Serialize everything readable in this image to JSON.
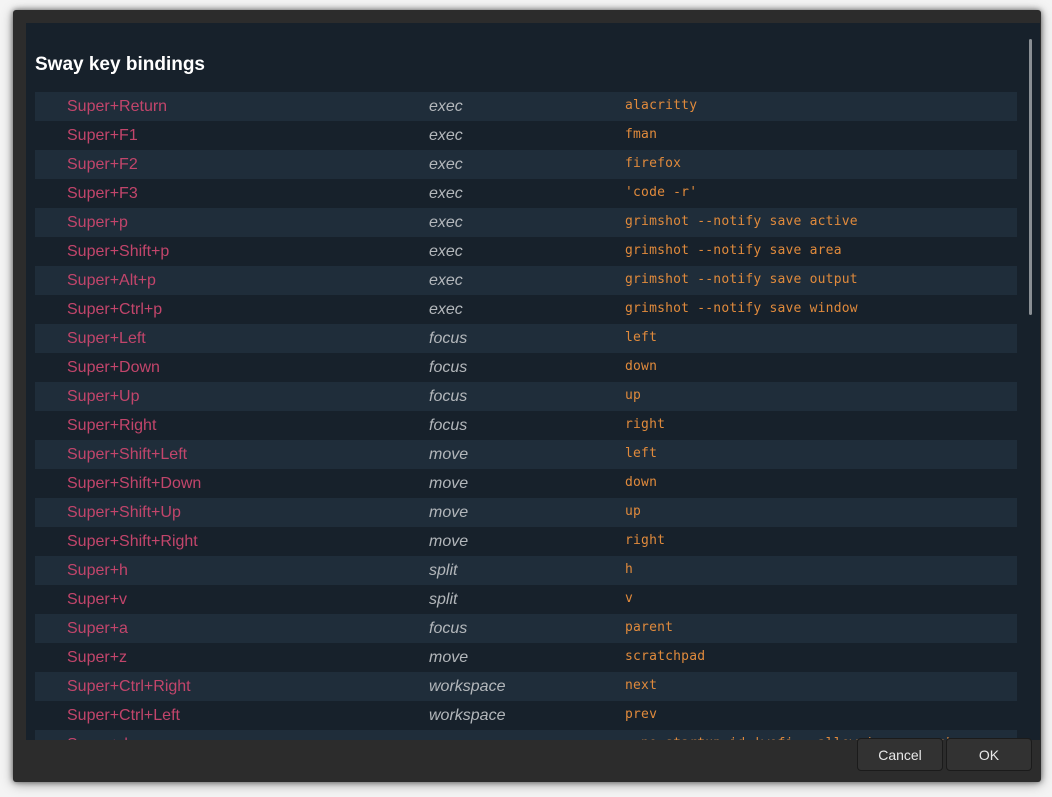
{
  "dialog": {
    "title": "Sway key bindings",
    "cancel_label": "Cancel",
    "ok_label": "OK"
  },
  "bindings": [
    {
      "key": "Super+Return",
      "action": "exec",
      "arg": "alacritty"
    },
    {
      "key": "Super+F1",
      "action": "exec",
      "arg": "fman"
    },
    {
      "key": "Super+F2",
      "action": "exec",
      "arg": "firefox"
    },
    {
      "key": "Super+F3",
      "action": "exec",
      "arg": "'code -r'"
    },
    {
      "key": "Super+p",
      "action": "exec",
      "arg": "grimshot --notify save active"
    },
    {
      "key": "Super+Shift+p",
      "action": "exec",
      "arg": "grimshot --notify save area"
    },
    {
      "key": "Super+Alt+p",
      "action": "exec",
      "arg": "grimshot --notify save output"
    },
    {
      "key": "Super+Ctrl+p",
      "action": "exec",
      "arg": "grimshot --notify save window"
    },
    {
      "key": "Super+Left",
      "action": "focus",
      "arg": "left"
    },
    {
      "key": "Super+Down",
      "action": "focus",
      "arg": "down"
    },
    {
      "key": "Super+Up",
      "action": "focus",
      "arg": "up"
    },
    {
      "key": "Super+Right",
      "action": "focus",
      "arg": "right"
    },
    {
      "key": "Super+Shift+Left",
      "action": "move",
      "arg": "left"
    },
    {
      "key": "Super+Shift+Down",
      "action": "move",
      "arg": "down"
    },
    {
      "key": "Super+Shift+Up",
      "action": "move",
      "arg": "up"
    },
    {
      "key": "Super+Shift+Right",
      "action": "move",
      "arg": "right"
    },
    {
      "key": "Super+h",
      "action": "split",
      "arg": "h"
    },
    {
      "key": "Super+v",
      "action": "split",
      "arg": "v"
    },
    {
      "key": "Super+a",
      "action": "focus",
      "arg": "parent"
    },
    {
      "key": "Super+z",
      "action": "move",
      "arg": "scratchpad"
    },
    {
      "key": "Super+Ctrl+Right",
      "action": "workspace",
      "arg": "next"
    },
    {
      "key": "Super+Ctrl+Left",
      "action": "workspace",
      "arg": "prev"
    },
    {
      "key": "Super+d",
      "action": "exec",
      "arg": "--no-startup-id 'wofi --allow-images --show"
    }
  ],
  "colors": {
    "key": "#c2456b",
    "action": "#b3b7bb",
    "arg": "#e08a3c",
    "row_alt": "#1f2d3a",
    "background": "#17212b"
  }
}
